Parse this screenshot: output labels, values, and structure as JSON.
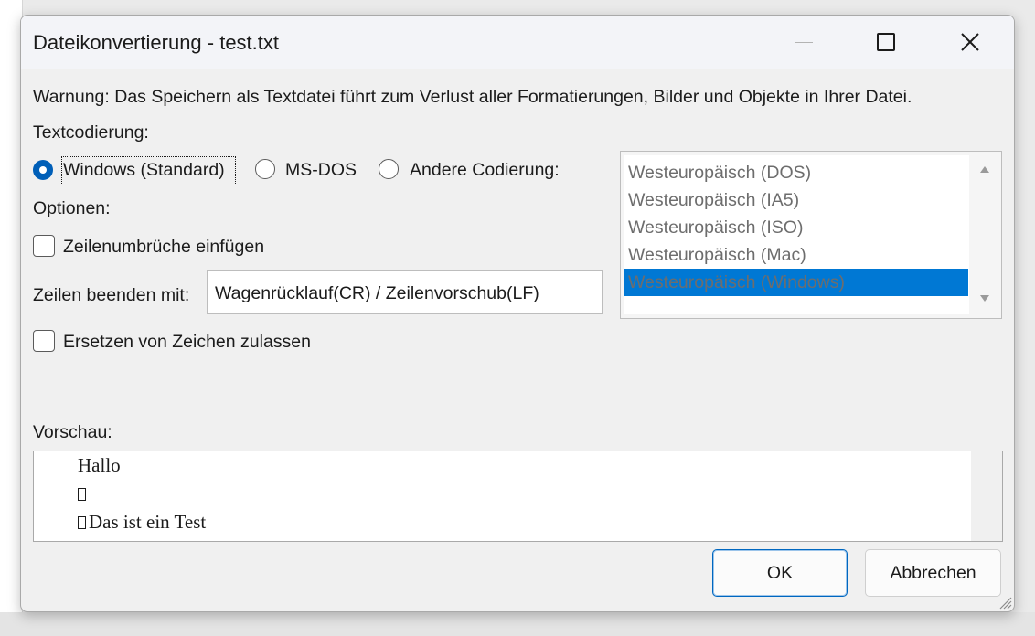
{
  "window": {
    "title": "Dateikonvertierung - test.txt"
  },
  "warning": "Warnung: Das Speichern als Textdatei führt zum Verlust aller Formatierungen, Bilder und Objekte in Ihrer Datei.",
  "encoding": {
    "label": "Textcodierung:",
    "options": [
      {
        "label": "Windows (Standard)",
        "checked": true
      },
      {
        "label": "MS-DOS",
        "checked": false
      },
      {
        "label": "Andere Codierung:",
        "checked": false
      }
    ],
    "list": {
      "items": [
        "Westeuropäisch (DOS)",
        "Westeuropäisch (IA5)",
        "Westeuropäisch (ISO)",
        "Westeuropäisch (Mac)",
        "Westeuropäisch (Windows)"
      ],
      "selected": "Westeuropäisch (Windows)"
    }
  },
  "options": {
    "label": "Optionen:",
    "line_breaks": {
      "label": "Zeilenumbrüche einfügen",
      "checked": false
    },
    "line_end": {
      "label": "Zeilen beenden mit:",
      "value": "Wagenrücklauf(CR) / Zeilenvorschub(LF)"
    },
    "replace_chars": {
      "label": "Ersetzen von Zeichen zulassen",
      "checked": false
    }
  },
  "preview": {
    "label": "Vorschau:",
    "lines": [
      "Hallo",
      "",
      "Das ist ein Test"
    ]
  },
  "buttons": {
    "ok": "OK",
    "cancel": "Abbrechen"
  },
  "colors": {
    "accent": "#005fb8",
    "selection": "#0078d4"
  }
}
